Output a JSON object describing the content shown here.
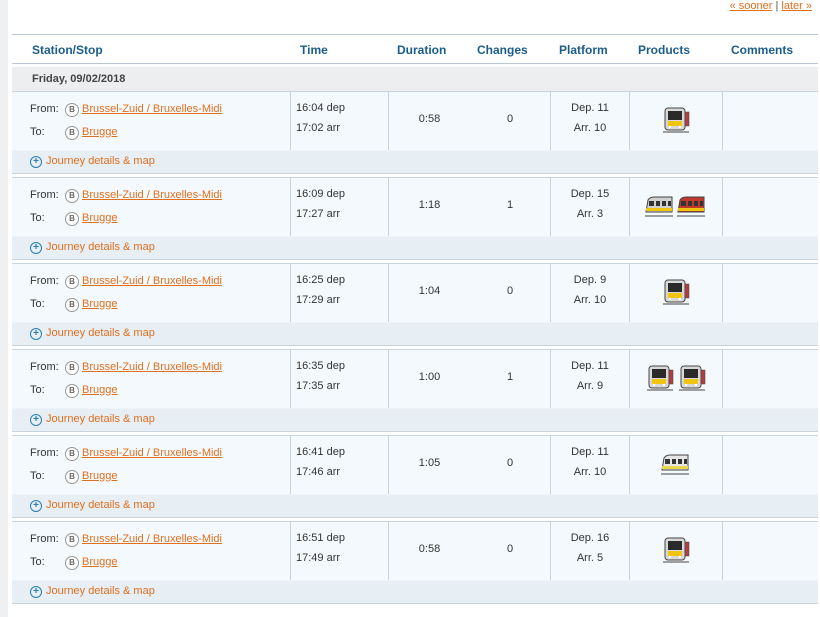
{
  "pager": {
    "sooner": "« sooner",
    "separator": "|",
    "later": "later »"
  },
  "headers": {
    "station": "Station/Stop",
    "time": "Time",
    "duration": "Duration",
    "changes": "Changes",
    "platform": "Platform",
    "products": "Products",
    "comments": "Comments"
  },
  "date": "Friday, 09/02/2018",
  "labels": {
    "from": "From:",
    "to": "To:",
    "details": "Journey details & map",
    "badge": "B"
  },
  "journeys": [
    {
      "from": "Brussel-Zuid / Bruxelles-Midi",
      "to": "Brugge",
      "dep": "16:04 dep",
      "arr": "17:02 arr",
      "duration": "0:58",
      "changes": "0",
      "platform_dep": "Dep. 11",
      "platform_arr": "Arr. 10",
      "products": [
        "train-front-icon"
      ]
    },
    {
      "from": "Brussel-Zuid / Bruxelles-Midi",
      "to": "Brugge",
      "dep": "16:09 dep",
      "arr": "17:27 arr",
      "duration": "1:18",
      "changes": "1",
      "platform_dep": "Dep. 15",
      "platform_arr": "Arr. 3",
      "products": [
        "train-side-icon",
        "train-red-icon"
      ]
    },
    {
      "from": "Brussel-Zuid / Bruxelles-Midi",
      "to": "Brugge",
      "dep": "16:25 dep",
      "arr": "17:29 arr",
      "duration": "1:04",
      "changes": "0",
      "platform_dep": "Dep. 9",
      "platform_arr": "Arr. 10",
      "products": [
        "train-front-icon"
      ]
    },
    {
      "from": "Brussel-Zuid / Bruxelles-Midi",
      "to": "Brugge",
      "dep": "16:35 dep",
      "arr": "17:35 arr",
      "duration": "1:00",
      "changes": "1",
      "platform_dep": "Dep. 11",
      "platform_arr": "Arr. 9",
      "products": [
        "train-front-icon",
        "train-front-icon"
      ]
    },
    {
      "from": "Brussel-Zuid / Bruxelles-Midi",
      "to": "Brugge",
      "dep": "16:41 dep",
      "arr": "17:46 arr",
      "duration": "1:05",
      "changes": "0",
      "platform_dep": "Dep. 11",
      "platform_arr": "Arr. 10",
      "products": [
        "train-light-icon"
      ]
    },
    {
      "from": "Brussel-Zuid / Bruxelles-Midi",
      "to": "Brugge",
      "dep": "16:51 dep",
      "arr": "17:49 arr",
      "duration": "0:58",
      "changes": "0",
      "platform_dep": "Dep. 16",
      "platform_arr": "Arr. 5",
      "products": [
        "train-front-icon"
      ]
    }
  ],
  "colors": {
    "link": "#e07020",
    "header": "#1a5d8a",
    "row_bg": "#f4f9fd",
    "details_bg": "#e7eef4",
    "plus": "#2a7fb5"
  }
}
